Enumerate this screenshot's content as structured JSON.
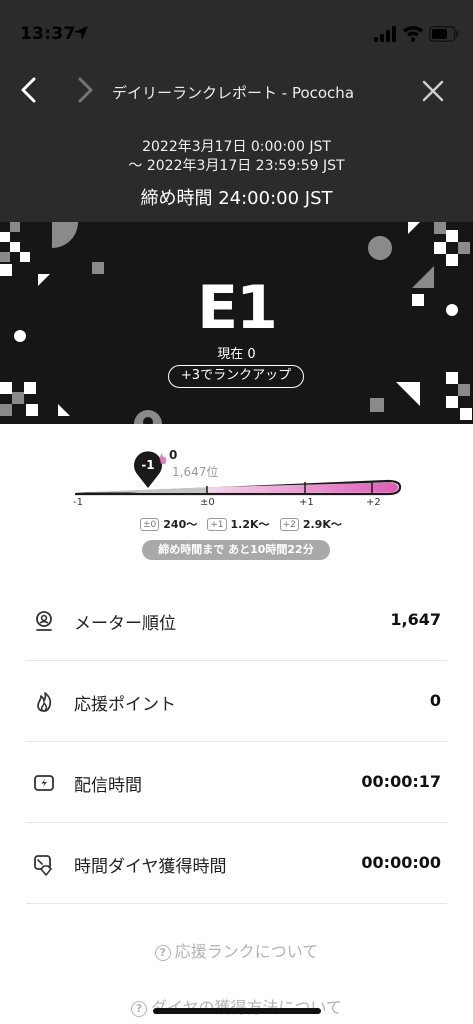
{
  "status_bar": {
    "time": "13:37"
  },
  "nav": {
    "title": "デイリーランクレポート - Pococha"
  },
  "period": {
    "start": "2022年3月17日 0:00:00 JST",
    "end": "〜 2022年3月17日 23:59:59 JST",
    "deadline": "締め時間 24:00:00 JST"
  },
  "rank": {
    "name": "E1",
    "current": "現在 0",
    "rankup": "+3でランクアップ"
  },
  "gauge": {
    "pin": "-1",
    "points": "0",
    "position": "1,647位",
    "ticks": [
      "-1",
      "±0",
      "+1",
      "+2"
    ],
    "chips": [
      {
        "tag": "±0",
        "value": "240〜"
      },
      {
        "tag": "+1",
        "value": "1.2K〜"
      },
      {
        "tag": "+2",
        "value": "2.9K〜"
      }
    ],
    "remaining": "締め時間まで あと10時間22分"
  },
  "stats": [
    {
      "label": "メーター順位",
      "value": "1,647",
      "icon": "rank-icon"
    },
    {
      "label": "応援ポイント",
      "value": "0",
      "icon": "flame-icon"
    },
    {
      "label": "配信時間",
      "value": "00:00:17",
      "icon": "broadcast-icon"
    },
    {
      "label": "時間ダイヤ獲得時間",
      "value": "00:00:00",
      "icon": "diamond-icon"
    }
  ],
  "links": {
    "about_rank": "応援ランクについて",
    "about_diamond": "ダイヤの獲得方法について"
  },
  "colors": {
    "header_bg": "#2b2b2b",
    "banner_bg": "#161616",
    "gauge_pink": "#e15ab8",
    "gauge_grey": "#c4c4c4"
  }
}
